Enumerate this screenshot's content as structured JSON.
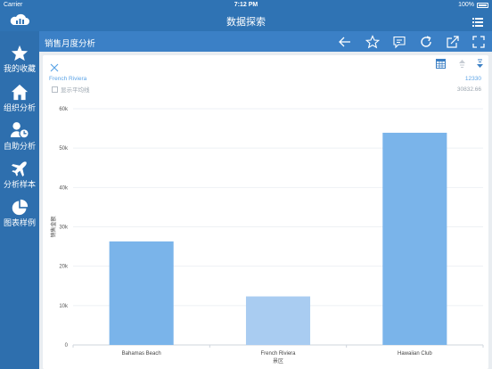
{
  "status": {
    "carrier": "Carrier",
    "time": "7:12 PM",
    "battery": "100%"
  },
  "app": {
    "title": "数据探索"
  },
  "sidebar": {
    "items": [
      {
        "label": "我的收藏",
        "icon": "star-icon"
      },
      {
        "label": "组织分析",
        "icon": "home-icon"
      },
      {
        "label": "自助分析",
        "icon": "user-clock-icon"
      },
      {
        "label": "分析样本",
        "icon": "airplane-icon"
      },
      {
        "label": "图表样例",
        "icon": "pie-icon"
      }
    ]
  },
  "toolbar": {
    "title": "销售月度分析"
  },
  "panel": {
    "selected_label": "French Riviera",
    "selected_value": "12330",
    "avg_label": "显示平均线",
    "avg_value": "30832.66"
  },
  "chart_data": {
    "type": "bar",
    "categories": [
      "Bahamas Beach",
      "French Riviera",
      "Hawaiian Club"
    ],
    "values": [
      26300,
      12330,
      53900
    ],
    "highlighted": "French Riviera",
    "xlabel": "景区",
    "ylabel": "销售金额",
    "ylim": [
      0,
      60000
    ],
    "yticks": [
      "0",
      "10k",
      "20k",
      "30k",
      "40k",
      "50k",
      "60k"
    ],
    "grid": true,
    "colors": {
      "bar": "#7ab4ea",
      "highlight": "#a9ccf1"
    }
  }
}
